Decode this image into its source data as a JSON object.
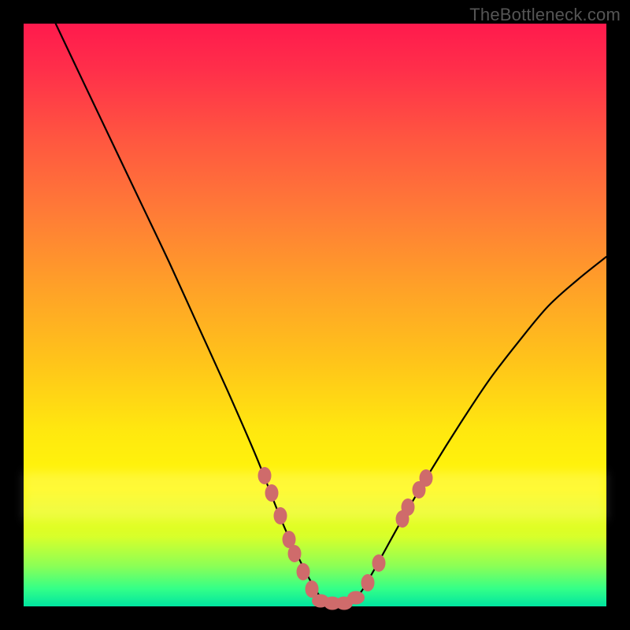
{
  "watermark": "TheBottleneck.com",
  "colors": {
    "curve": "#000000",
    "dots": "#cf6b6b",
    "frame": "#000000"
  },
  "chart_data": {
    "type": "line",
    "title": "",
    "xlabel": "",
    "ylabel": "",
    "xlim": [
      0,
      1
    ],
    "ylim": [
      0,
      1
    ],
    "series": [
      {
        "name": "curve",
        "x": [
          0.055,
          0.1,
          0.15,
          0.2,
          0.25,
          0.3,
          0.35,
          0.4,
          0.45,
          0.5,
          0.525,
          0.55,
          0.575,
          0.6,
          0.65,
          0.7,
          0.75,
          0.8,
          0.85,
          0.9,
          0.95,
          1.0
        ],
        "y": [
          1.0,
          0.905,
          0.8,
          0.695,
          0.59,
          0.48,
          0.37,
          0.255,
          0.13,
          0.03,
          0.005,
          0.005,
          0.02,
          0.06,
          0.15,
          0.235,
          0.315,
          0.39,
          0.455,
          0.515,
          0.56,
          0.6
        ]
      }
    ],
    "markers": [
      {
        "x": 0.413,
        "y": 0.225
      },
      {
        "x": 0.425,
        "y": 0.195
      },
      {
        "x": 0.44,
        "y": 0.155
      },
      {
        "x": 0.455,
        "y": 0.115
      },
      {
        "x": 0.465,
        "y": 0.09
      },
      {
        "x": 0.48,
        "y": 0.06
      },
      {
        "x": 0.495,
        "y": 0.03
      },
      {
        "x": 0.51,
        "y": 0.01,
        "wide": true
      },
      {
        "x": 0.53,
        "y": 0.005,
        "wide": true
      },
      {
        "x": 0.55,
        "y": 0.005,
        "wide": true
      },
      {
        "x": 0.57,
        "y": 0.015,
        "wide": true
      },
      {
        "x": 0.59,
        "y": 0.04
      },
      {
        "x": 0.61,
        "y": 0.075
      },
      {
        "x": 0.65,
        "y": 0.15
      },
      {
        "x": 0.66,
        "y": 0.17
      },
      {
        "x": 0.678,
        "y": 0.2
      },
      {
        "x": 0.69,
        "y": 0.22
      }
    ],
    "annotations": []
  }
}
